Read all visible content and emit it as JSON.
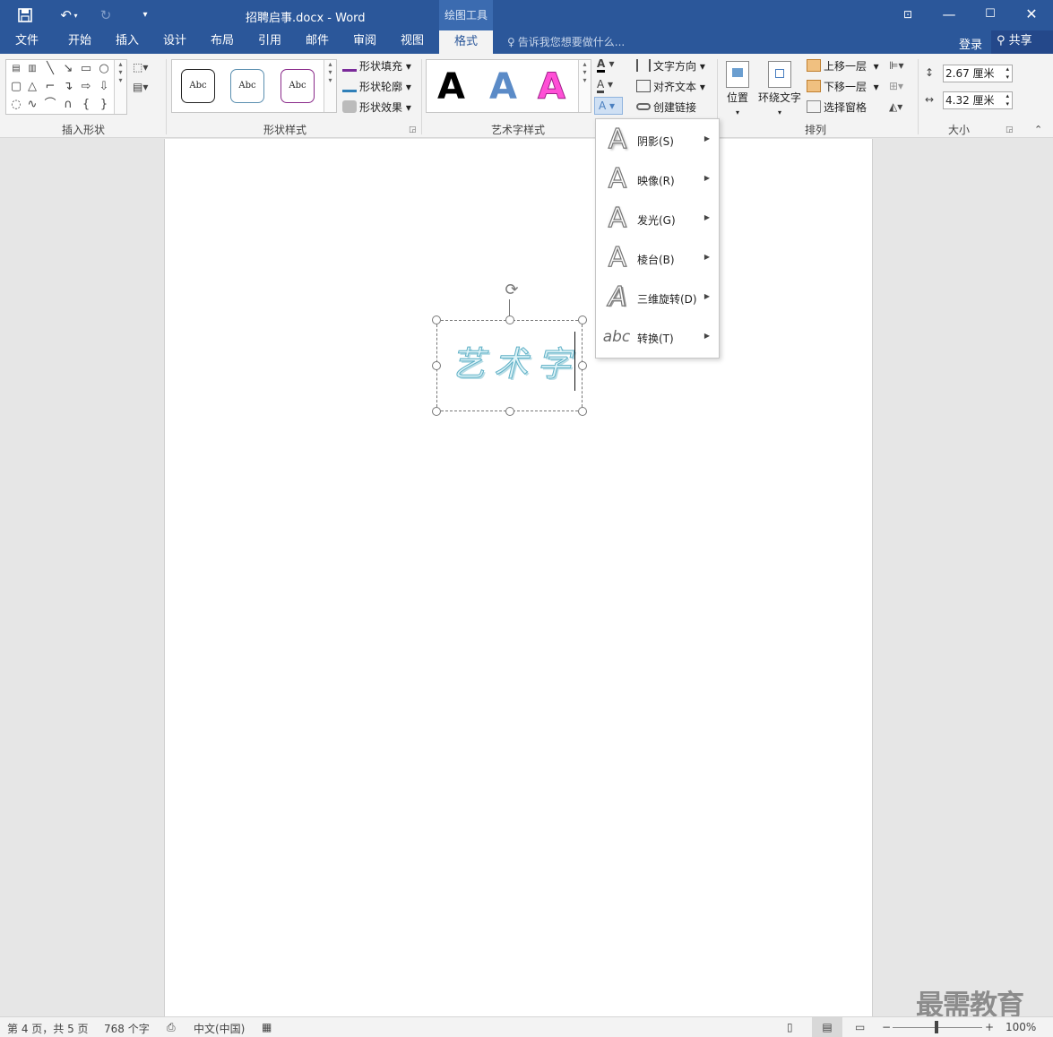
{
  "titlebar": {
    "doc_title": "招聘启事.docx - Word",
    "context_tab": "绘图工具",
    "bg_color": "#2b579a"
  },
  "tabs": [
    "文件",
    "开始",
    "插入",
    "设计",
    "布局",
    "引用",
    "邮件",
    "审阅",
    "视图",
    "格式"
  ],
  "tell_me": "告诉我您想要做什么...",
  "account": {
    "login": "登录",
    "share": "共享"
  },
  "ribbon": {
    "groups": {
      "insert_shapes": "插入形状",
      "shape_styles": "形状样式",
      "wordart_styles": "艺术字样式",
      "arrange": "排列",
      "size": "大小"
    },
    "shape_style_buttons": {
      "fill": "形状填充",
      "outline": "形状轮廓",
      "effects": "形状效果"
    },
    "shape_style_samples": [
      "Abc",
      "Abc",
      "Abc"
    ],
    "wordart_samples": [
      "A",
      "A",
      "A"
    ],
    "text_buttons": {
      "direction": "文字方向",
      "align": "对齐文本",
      "link": "创建链接"
    },
    "arrange_buttons": {
      "position": "位置",
      "wrap": "环绕文字",
      "forward": "上移一层",
      "backward": "下移一层",
      "selection_pane": "选择窗格"
    },
    "size": {
      "height": "2.67 厘米",
      "width": "4.32 厘米"
    }
  },
  "document": {
    "wordart_text": "艺术字"
  },
  "text_effects_menu": [
    {
      "label": "阴影(S)",
      "glyph": "A"
    },
    {
      "label": "映像(R)",
      "glyph": "A"
    },
    {
      "label": "发光(G)",
      "glyph": "A"
    },
    {
      "label": "棱台(B)",
      "glyph": "A"
    },
    {
      "label": "三维旋转(D)",
      "glyph": "A"
    },
    {
      "label": "转换(T)",
      "glyph": "abc"
    }
  ],
  "statusbar": {
    "page": "第 4 页，共 5 页",
    "words": "768 个字",
    "language": "中文(中国)",
    "zoom": "100%"
  },
  "watermark": "最需教育"
}
